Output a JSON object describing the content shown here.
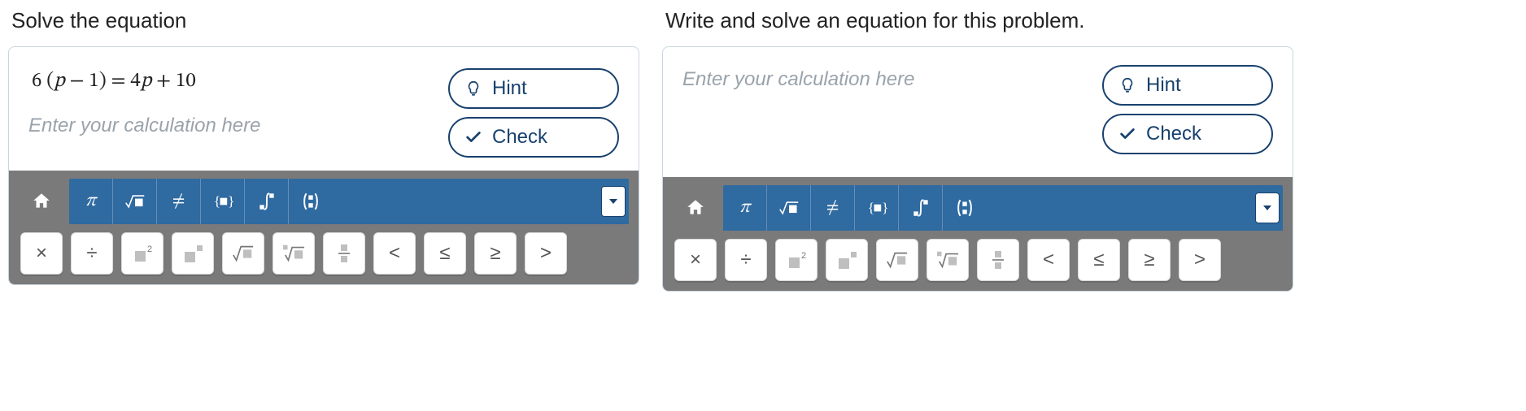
{
  "left": {
    "prompt": "Solve the equation",
    "equation_html": "6 (<span class='eq-var'>p</span> − 1) = 4<span class='eq-var'>p</span> + 10",
    "input_placeholder": "Enter your calculation here",
    "buttons": {
      "hint": "Hint",
      "check": "Check"
    },
    "tabs": [
      "home",
      "pi",
      "sqrt",
      "neq",
      "set",
      "integral",
      "combinatorics"
    ],
    "keys": [
      "multiply",
      "divide",
      "square",
      "power",
      "sqrt",
      "nroot",
      "fraction",
      "lt",
      "le",
      "ge",
      "gt"
    ]
  },
  "right": {
    "prompt": "Write and solve an equation for this problem.",
    "input_placeholder": "Enter your calculation here",
    "buttons": {
      "hint": "Hint",
      "check": "Check"
    },
    "tabs": [
      "home",
      "pi",
      "sqrt",
      "neq",
      "set",
      "integral",
      "combinatorics"
    ],
    "keys": [
      "multiply",
      "divide",
      "square",
      "power",
      "sqrt",
      "nroot",
      "fraction",
      "lt",
      "le",
      "ge",
      "gt"
    ]
  },
  "glyphs": {
    "multiply": "×",
    "divide": "÷",
    "lt": "<",
    "le": "≤",
    "ge": "≥",
    "gt": ">",
    "pi": "π",
    "neq": "≠"
  }
}
